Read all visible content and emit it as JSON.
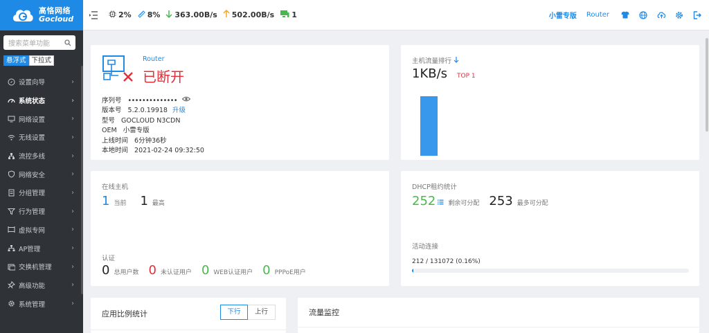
{
  "brand": {
    "name_cn": "高恪网络",
    "name_en": "Gocloud"
  },
  "sidebar": {
    "search_placeholder": "搜索菜单功能",
    "modes": [
      "悬浮式",
      "下拉式"
    ],
    "items": [
      {
        "label": "设置向导",
        "icon": "compass-icon"
      },
      {
        "label": "系统状态",
        "icon": "dashboard-icon"
      },
      {
        "label": "网络设置",
        "icon": "monitor-icon"
      },
      {
        "label": "无线设置",
        "icon": "wifi-icon"
      },
      {
        "label": "流控多线",
        "icon": "network-icon"
      },
      {
        "label": "网络安全",
        "icon": "shield-icon"
      },
      {
        "label": "分组管理",
        "icon": "document-icon"
      },
      {
        "label": "行为管理",
        "icon": "filter-icon"
      },
      {
        "label": "虚拟专网",
        "icon": "vpn-icon"
      },
      {
        "label": "AP管理",
        "icon": "sitemap-icon"
      },
      {
        "label": "交换机管理",
        "icon": "switch-icon"
      },
      {
        "label": "高级功能",
        "icon": "pin-icon"
      },
      {
        "label": "系统管理",
        "icon": "gear-icon"
      }
    ]
  },
  "topbar": {
    "cpu": "2%",
    "mem": "8%",
    "down": "363.00B/s",
    "up": "502.00B/s",
    "hosts": "1",
    "edition": "小雷专版",
    "router": "Router"
  },
  "device": {
    "name": "Router",
    "status": "已断开",
    "serial_label": "序列号",
    "serial_value": "••••••••••••••",
    "version_label": "版本号",
    "version_value": "5.2.0.19918",
    "upgrade": "升级",
    "model_label": "型号",
    "model_value": "GOCLOUD N3CDN",
    "oem_label": "OEM",
    "oem_value": "小雷专版",
    "uptime_label": "上线时间",
    "uptime_value": "6分钟36秒",
    "time_label": "本地时间",
    "time_value": "2021-02-24 09:32:50"
  },
  "traffic_rank": {
    "title": "主机流量排行",
    "value": "1KB/s",
    "badge": "TOP 1",
    "bar_fraction": 1.0
  },
  "online": {
    "title": "在线主机",
    "current": "1",
    "current_label": "当前",
    "max": "1",
    "max_label": "最高"
  },
  "auth": {
    "title": "认证",
    "items": [
      {
        "value": "0",
        "label": "总用户数",
        "color": "#222222"
      },
      {
        "value": "0",
        "label": "未认证用户",
        "color": "#e0303a"
      },
      {
        "value": "0",
        "label": "WEB认证用户",
        "color": "#49b84a"
      },
      {
        "value": "0",
        "label": "PPPoE用户",
        "color": "#49b84a"
      }
    ]
  },
  "dhcp": {
    "title": "DHCP租约统计",
    "remaining": "252",
    "remaining_label": "剩余可分配",
    "max": "253",
    "max_label": "最多可分配"
  },
  "connections": {
    "title": "活动连接",
    "value": "212 / 131072 (0.16%)",
    "fraction": 0.0016
  },
  "app_stats": {
    "title": "应用比例统计",
    "tabs": [
      "下行",
      "上行"
    ]
  },
  "flow_monitor": {
    "title": "流量监控"
  },
  "colors": {
    "accent": "#1e8ae6",
    "sidebar": "#2f3338",
    "danger": "#e0303a",
    "success": "#49b84a",
    "warn": "#f5a623"
  }
}
